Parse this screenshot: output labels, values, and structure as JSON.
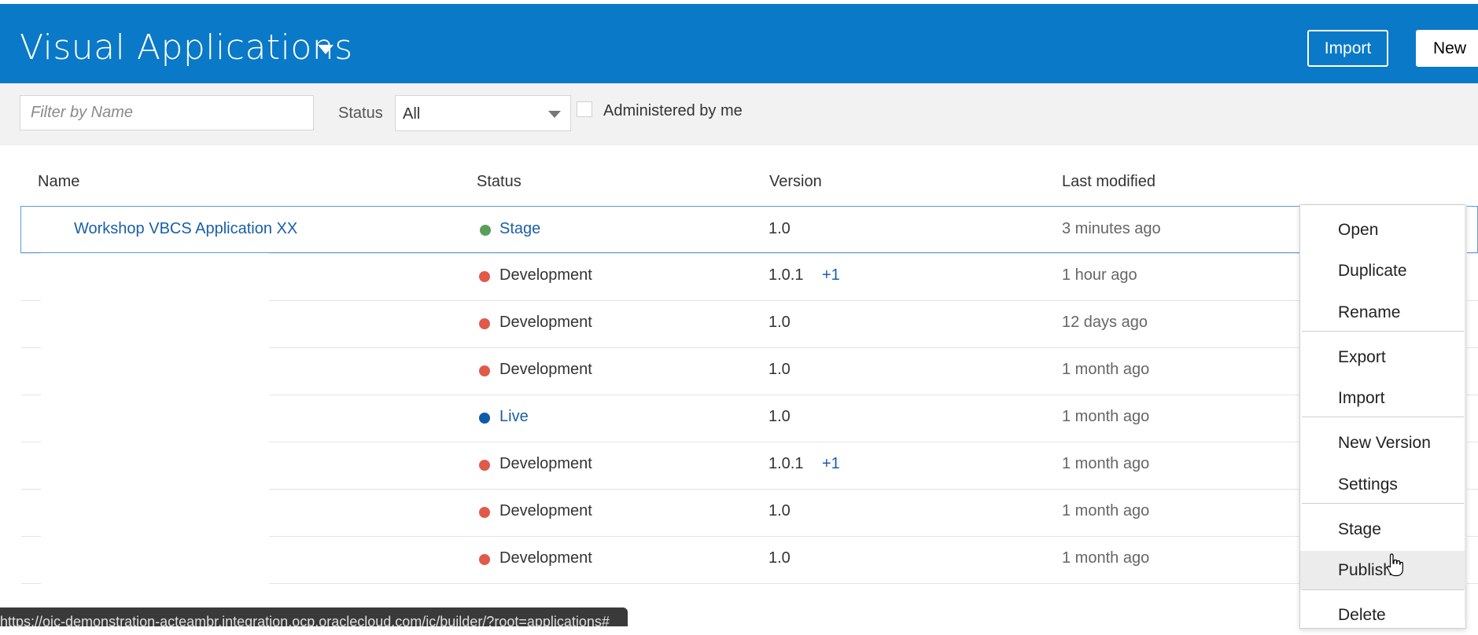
{
  "header": {
    "title": "Visual Applications",
    "import_label": "Import",
    "new_label": "New"
  },
  "filters": {
    "name_placeholder": "Filter by Name",
    "status_label": "Status",
    "status_value": "All",
    "administered_label": "Administered by me",
    "administered_checked": false
  },
  "table": {
    "columns": [
      "Name",
      "Status",
      "Version",
      "Last modified"
    ],
    "rows": [
      {
        "name": "Workshop VBCS Application XX",
        "status": "Stage",
        "status_color": "#5a9e5a",
        "version": "1.0",
        "extra": "",
        "modified": "3 minutes ago"
      },
      {
        "name": "",
        "status": "Development",
        "status_color": "#e05a4a",
        "version": "1.0.1",
        "extra": "+1",
        "modified": "1 hour ago"
      },
      {
        "name": "",
        "status": "Development",
        "status_color": "#e05a4a",
        "version": "1.0",
        "extra": "",
        "modified": "12 days ago"
      },
      {
        "name": "",
        "status": "Development",
        "status_color": "#e05a4a",
        "version": "1.0",
        "extra": "",
        "modified": "1 month ago"
      },
      {
        "name": "",
        "status": "Live",
        "status_color": "#0d5ca8",
        "version": "1.0",
        "extra": "",
        "modified": "1 month ago"
      },
      {
        "name": "",
        "status": "Development",
        "status_color": "#e05a4a",
        "version": "1.0.1",
        "extra": "+1",
        "modified": "1 month ago"
      },
      {
        "name": "",
        "status": "Development",
        "status_color": "#e05a4a",
        "version": "1.0",
        "extra": "",
        "modified": "1 month ago"
      },
      {
        "name": "",
        "status": "Development",
        "status_color": "#e05a4a",
        "version": "1.0",
        "extra": "",
        "modified": "1 month ago"
      }
    ]
  },
  "menu": {
    "items": [
      "Open",
      "Duplicate",
      "Rename",
      "Export",
      "Import",
      "New Version",
      "Settings",
      "Stage",
      "Publish",
      "Delete"
    ],
    "hovered": "Publish"
  },
  "statusbar": {
    "url": "https://oic-demonstration-acteambr.integration.ocp.oraclecloud.com/ic/builder/?root=applications#"
  },
  "colors": {
    "header_bg": "#0a79c8",
    "link": "#1a5fa8",
    "filter_bg": "#f2f2f2"
  }
}
